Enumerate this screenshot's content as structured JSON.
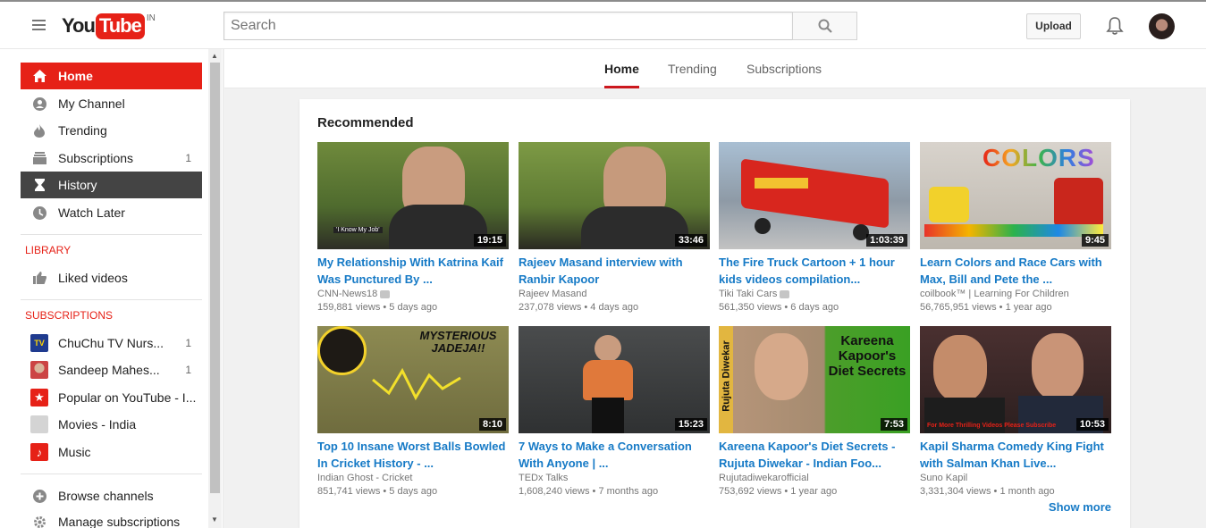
{
  "masthead": {
    "logo_you": "You",
    "logo_tube": "Tube",
    "country": "IN",
    "search_placeholder": "Search",
    "upload_label": "Upload"
  },
  "sidebar": {
    "nav": [
      {
        "label": "Home",
        "icon": "home-icon"
      },
      {
        "label": "My Channel",
        "icon": "person-icon"
      },
      {
        "label": "Trending",
        "icon": "flame-icon"
      },
      {
        "label": "Subscriptions",
        "icon": "subscriptions-icon",
        "count": "1"
      },
      {
        "label": "History",
        "icon": "hourglass-icon"
      },
      {
        "label": "Watch Later",
        "icon": "clock-icon"
      }
    ],
    "library_title": "LIBRARY",
    "library": [
      {
        "label": "Liked videos",
        "icon": "thumbs-up-icon"
      }
    ],
    "subscriptions_title": "SUBSCRIPTIONS",
    "subscriptions": [
      {
        "label": "ChuChu TV Nurs...",
        "count": "1",
        "icon_text": "TV",
        "color": "#1f3b8f"
      },
      {
        "label": "Sandeep Mahes...",
        "count": "1",
        "icon_text": "",
        "color": "#8a5a44"
      },
      {
        "label": "Popular on YouTube - I...",
        "count": "",
        "icon_text": "★",
        "color": "#e62117"
      },
      {
        "label": "Movies - India",
        "count": "",
        "icon_text": "",
        "color": "#cfcfcf"
      },
      {
        "label": "Music",
        "count": "",
        "icon_text": "♪",
        "color": "#e62117"
      }
    ],
    "footer": [
      {
        "label": "Browse channels",
        "icon": "plus-circle-icon"
      },
      {
        "label": "Manage subscriptions",
        "icon": "gear-icon"
      }
    ]
  },
  "tabs": [
    "Home",
    "Trending",
    "Subscriptions"
  ],
  "recommended": {
    "title": "Recommended",
    "show_more": "Show more",
    "videos": [
      {
        "title": "My Relationship With Katrina Kaif Was Punctured By ...",
        "channel": "CNN-News18",
        "verified": true,
        "views": "159,881 views",
        "age": "5 days ago",
        "duration": "19:15",
        "caption": "'I Know My Job'",
        "bg": "#4f6b2e"
      },
      {
        "title": "Rajeev Masand interview with Ranbir Kapoor",
        "channel": "Rajeev Masand",
        "verified": false,
        "views": "237,078 views",
        "age": "4 days ago",
        "duration": "33:46",
        "caption": "",
        "bg": "#5e7a33"
      },
      {
        "title": "The Fire Truck Cartoon + 1 hour kids videos compilation...",
        "channel": "Tiki Taki Cars",
        "verified": true,
        "views": "561,350 views",
        "age": "6 days ago",
        "duration": "1:03:39",
        "caption": "",
        "bg": "#9aa7b3"
      },
      {
        "title": "Learn Colors and Race Cars with Max, Bill and Pete the ...",
        "channel": "coilbook™ | Learning For Children",
        "verified": false,
        "views": "56,765,951 views",
        "age": "1 year ago",
        "duration": "9:45",
        "caption": "COLORS",
        "bg": "#c9c4bd"
      },
      {
        "title": "Top 10 Insane Worst Balls Bowled In Cricket History - ...",
        "channel": "Indian Ghost - Cricket",
        "verified": false,
        "views": "851,741 views",
        "age": "5 days ago",
        "duration": "8:10",
        "caption": "MYSTERIOUS JADEJA!!",
        "bg": "#7d7a4a"
      },
      {
        "title": "7 Ways to Make a Conversation With Anyone | ...",
        "channel": "TEDx Talks",
        "verified": false,
        "views": "1,608,240 views",
        "age": "7 months ago",
        "duration": "15:23",
        "caption": "",
        "bg": "#3a3c3d"
      },
      {
        "title": "Kareena Kapoor's Diet Secrets - Rujuta Diwekar - Indian Foo...",
        "channel": "Rujutadiwekarofficial",
        "verified": false,
        "views": "753,692 views",
        "age": "1 year ago",
        "duration": "7:53",
        "caption": "Kareena Kapoor's Diet Secrets",
        "side": "Rujuta Diwekar",
        "bg": "#a58b70"
      },
      {
        "title": "Kapil Sharma Comedy King Fight with Salman Khan Live...",
        "channel": "Suno Kapil",
        "verified": false,
        "views": "3,331,304 views",
        "age": "1 month ago",
        "duration": "10:53",
        "caption": "For More Thrilling Videos Please Subscribe",
        "bg": "#3b2a2a"
      }
    ]
  }
}
